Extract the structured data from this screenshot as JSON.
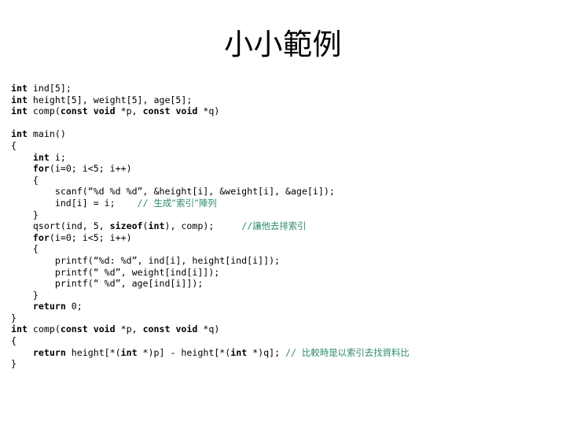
{
  "slide": {
    "title": "小小範例",
    "background_color": "#ffffff",
    "text_color": "#000000",
    "comment_color": "#2e8b6b"
  },
  "code": {
    "language": "c",
    "lines": [
      {
        "id": "decl-ind",
        "indent": 0,
        "segments": [
          {
            "text": "int",
            "style": "keyword"
          },
          {
            "text": " ind[5];",
            "style": "plain"
          }
        ]
      },
      {
        "id": "decl-arrays",
        "indent": 0,
        "segments": [
          {
            "text": "int",
            "style": "keyword"
          },
          {
            "text": " height[5], weight[5], age[5];",
            "style": "plain"
          }
        ]
      },
      {
        "id": "proto-comp",
        "indent": 0,
        "segments": [
          {
            "text": "int",
            "style": "keyword"
          },
          {
            "text": " comp(",
            "style": "plain"
          },
          {
            "text": "const void",
            "style": "keyword"
          },
          {
            "text": " *p, ",
            "style": "plain"
          },
          {
            "text": "const void",
            "style": "keyword"
          },
          {
            "text": " *q)",
            "style": "plain"
          }
        ]
      },
      {
        "id": "blank-1",
        "indent": 0,
        "segments": []
      },
      {
        "id": "main-header",
        "indent": 0,
        "segments": [
          {
            "text": "int",
            "style": "keyword"
          },
          {
            "text": " main()",
            "style": "plain"
          }
        ]
      },
      {
        "id": "main-open-brace",
        "indent": 0,
        "segments": [
          {
            "text": "{",
            "style": "plain"
          }
        ]
      },
      {
        "id": "decl-i",
        "indent": 1,
        "segments": [
          {
            "text": "int",
            "style": "keyword"
          },
          {
            "text": " i;",
            "style": "plain"
          }
        ]
      },
      {
        "id": "for-input",
        "indent": 1,
        "segments": [
          {
            "text": "for",
            "style": "keyword"
          },
          {
            "text": "(i=0; i<5; i++)",
            "style": "plain"
          }
        ]
      },
      {
        "id": "for-input-open",
        "indent": 1,
        "segments": [
          {
            "text": "{",
            "style": "plain"
          }
        ]
      },
      {
        "id": "scanf-line",
        "indent": 2,
        "segments": [
          {
            "text": "scanf(“%d %d %d”, &height[i], &weight[i], &age[i]);",
            "style": "plain"
          }
        ]
      },
      {
        "id": "ind-assign",
        "indent": 2,
        "segments": [
          {
            "text": "ind[i] = i;",
            "style": "plain"
          },
          {
            "text": "    ",
            "style": "plain"
          },
          {
            "text": "// ",
            "style": "comment"
          },
          {
            "text": "生成“索引”陣列",
            "style": "comment-cjk"
          }
        ]
      },
      {
        "id": "for-input-close",
        "indent": 1,
        "segments": [
          {
            "text": "}",
            "style": "plain"
          }
        ]
      },
      {
        "id": "qsort-line",
        "indent": 1,
        "segments": [
          {
            "text": "qsort(ind, 5, ",
            "style": "plain"
          },
          {
            "text": "sizeof",
            "style": "keyword"
          },
          {
            "text": "(",
            "style": "plain"
          },
          {
            "text": "int",
            "style": "keyword"
          },
          {
            "text": "), comp);",
            "style": "plain"
          },
          {
            "text": "     ",
            "style": "plain"
          },
          {
            "text": "//",
            "style": "comment"
          },
          {
            "text": "讓他去排索引",
            "style": "comment-cjk"
          }
        ]
      },
      {
        "id": "for-output",
        "indent": 1,
        "segments": [
          {
            "text": "for",
            "style": "keyword"
          },
          {
            "text": "(i=0; i<5; i++)",
            "style": "plain"
          }
        ]
      },
      {
        "id": "for-output-open",
        "indent": 1,
        "segments": [
          {
            "text": "{",
            "style": "plain"
          }
        ]
      },
      {
        "id": "printf-1",
        "indent": 2,
        "segments": [
          {
            "text": "printf(“%d: %d”, ind[i], height[ind[i]]);",
            "style": "plain"
          }
        ]
      },
      {
        "id": "printf-2",
        "indent": 2,
        "segments": [
          {
            "text": "printf(“ %d”, weight[ind[i]]);",
            "style": "plain"
          }
        ]
      },
      {
        "id": "printf-3",
        "indent": 2,
        "segments": [
          {
            "text": "printf(“ %d”, age[ind[i]]);",
            "style": "plain"
          }
        ]
      },
      {
        "id": "for-output-close",
        "indent": 1,
        "segments": [
          {
            "text": "}",
            "style": "plain"
          }
        ]
      },
      {
        "id": "return-zero",
        "indent": 1,
        "segments": [
          {
            "text": "return",
            "style": "keyword"
          },
          {
            "text": " 0;",
            "style": "plain"
          }
        ]
      },
      {
        "id": "main-close-brace",
        "indent": 0,
        "segments": [
          {
            "text": "}",
            "style": "plain"
          }
        ]
      },
      {
        "id": "comp-header",
        "indent": 0,
        "segments": [
          {
            "text": "int",
            "style": "keyword"
          },
          {
            "text": " comp(",
            "style": "plain"
          },
          {
            "text": "const void",
            "style": "keyword"
          },
          {
            "text": " *p, ",
            "style": "plain"
          },
          {
            "text": "const void",
            "style": "keyword"
          },
          {
            "text": " *q)",
            "style": "plain"
          }
        ]
      },
      {
        "id": "comp-open-brace",
        "indent": 0,
        "segments": [
          {
            "text": "{",
            "style": "plain"
          }
        ]
      },
      {
        "id": "comp-return",
        "indent": 1,
        "segments": [
          {
            "text": "return",
            "style": "keyword"
          },
          {
            "text": " height[*(",
            "style": "plain"
          },
          {
            "text": "int",
            "style": "keyword"
          },
          {
            "text": " *)p] - height[*(",
            "style": "plain"
          },
          {
            "text": "int",
            "style": "keyword"
          },
          {
            "text": " *)q]; ",
            "style": "plain"
          },
          {
            "text": "// ",
            "style": "comment"
          },
          {
            "text": "比較時是以索引去找資料比",
            "style": "comment-cjk"
          }
        ]
      },
      {
        "id": "comp-close-brace",
        "indent": 0,
        "segments": [
          {
            "text": "}",
            "style": "plain"
          }
        ]
      }
    ]
  }
}
